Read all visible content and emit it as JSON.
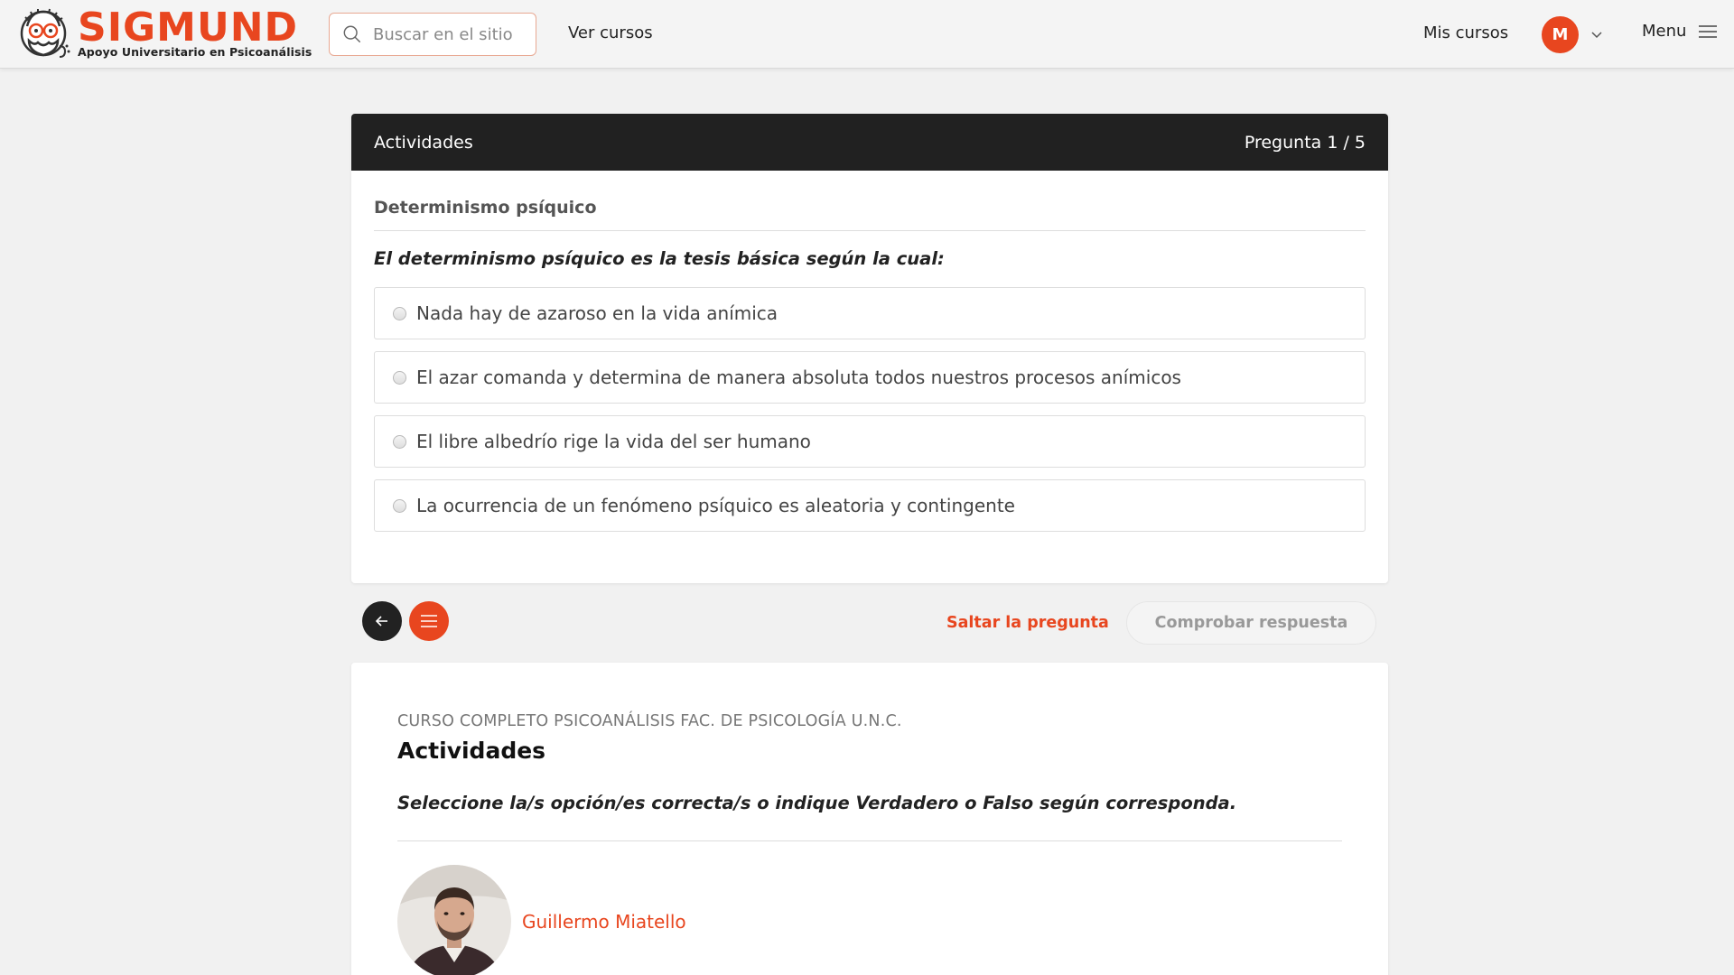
{
  "header": {
    "logo_title": "SIGMUND",
    "logo_subtitle": "Apoyo Universitario en Psicoanálisis",
    "search_placeholder": "Buscar en el sitio",
    "nav_courses": "Ver cursos",
    "my_courses": "Mis cursos",
    "avatar_initial": "M",
    "menu_label": "Menu"
  },
  "quiz": {
    "section_title": "Actividades",
    "progress": "Pregunta 1 / 5",
    "topic": "Determinismo psíquico",
    "question": "El determinismo psíquico es la tesis básica según la cual:",
    "options": [
      {
        "label": "Nada hay de azaroso en la vida anímica"
      },
      {
        "label": "El azar comanda y determina de manera absoluta todos nuestros procesos anímicos"
      },
      {
        "label": "El libre albedrío rige la vida del ser humano"
      },
      {
        "label": "La ocurrencia de un fenómeno psíquico es aleatoria y contingente"
      }
    ]
  },
  "controls": {
    "skip_label": "Saltar la pregunta",
    "check_label": "Comprobar respuesta"
  },
  "course": {
    "name": "CURSO COMPLETO PSICOANÁLISIS FAC. DE PSICOLOGÍA U.N.C.",
    "section": "Actividades",
    "instructions": "Seleccione la/s opción/es correcta/s o indique Verdadero o Falso según corresponda.",
    "author_name": "Guillermo Miatello"
  },
  "colors": {
    "accent": "#e8461f",
    "header_bar": "#212121",
    "background": "#f1f1f1"
  },
  "icons": {
    "search": "search-icon",
    "chevron": "chevron-down-icon",
    "menu": "hamburger-menu-icon",
    "back": "arrow-left-icon",
    "list": "list-icon"
  }
}
